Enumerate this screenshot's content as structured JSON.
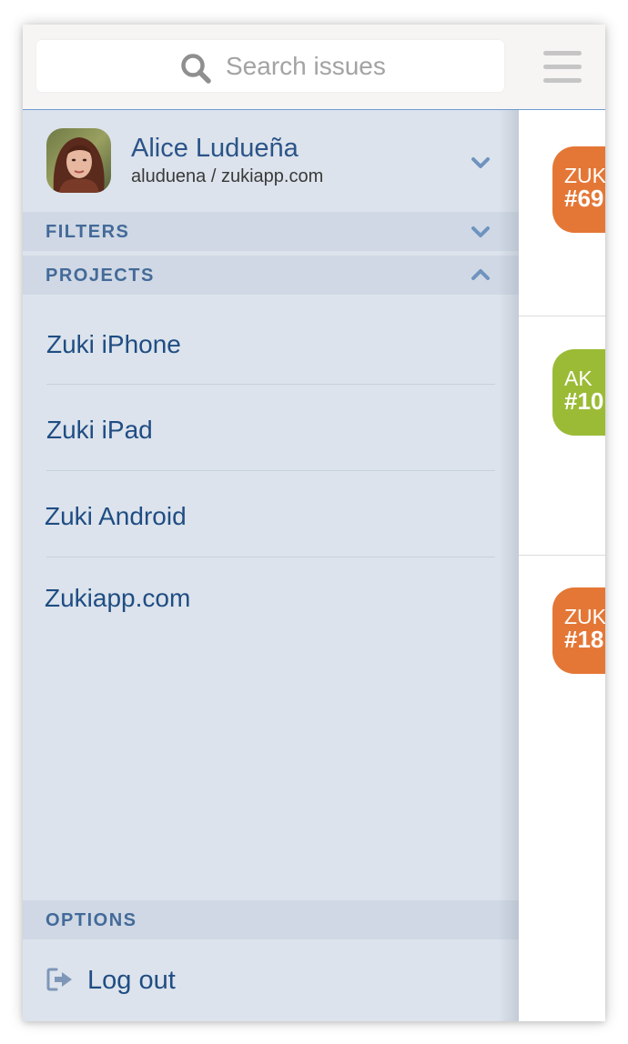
{
  "search": {
    "placeholder": "Search issues"
  },
  "user": {
    "name": "Alice Ludueña",
    "account": "aluduena / zukiapp.com"
  },
  "sections": {
    "filters": "FILTERS",
    "projects": "PROJECTS",
    "options": "OPTIONS"
  },
  "projects": [
    {
      "label": "Zuki iPhone"
    },
    {
      "label": "Zuki iPad"
    },
    {
      "label": "Zuki Android"
    },
    {
      "label": "Zukiapp.com"
    }
  ],
  "options": {
    "logout": "Log out"
  },
  "issues": [
    {
      "project": "ZUK",
      "number": "#69",
      "color": "#e47736"
    },
    {
      "project": "AK",
      "number": "#10",
      "color": "#9bbb36"
    },
    {
      "project": "ZUK",
      "number": "#18",
      "color": "#e47736"
    }
  ],
  "colors": {
    "accent": "#2b5488",
    "section_header": "#436a99",
    "drawer_bg": "#dce3ec"
  }
}
